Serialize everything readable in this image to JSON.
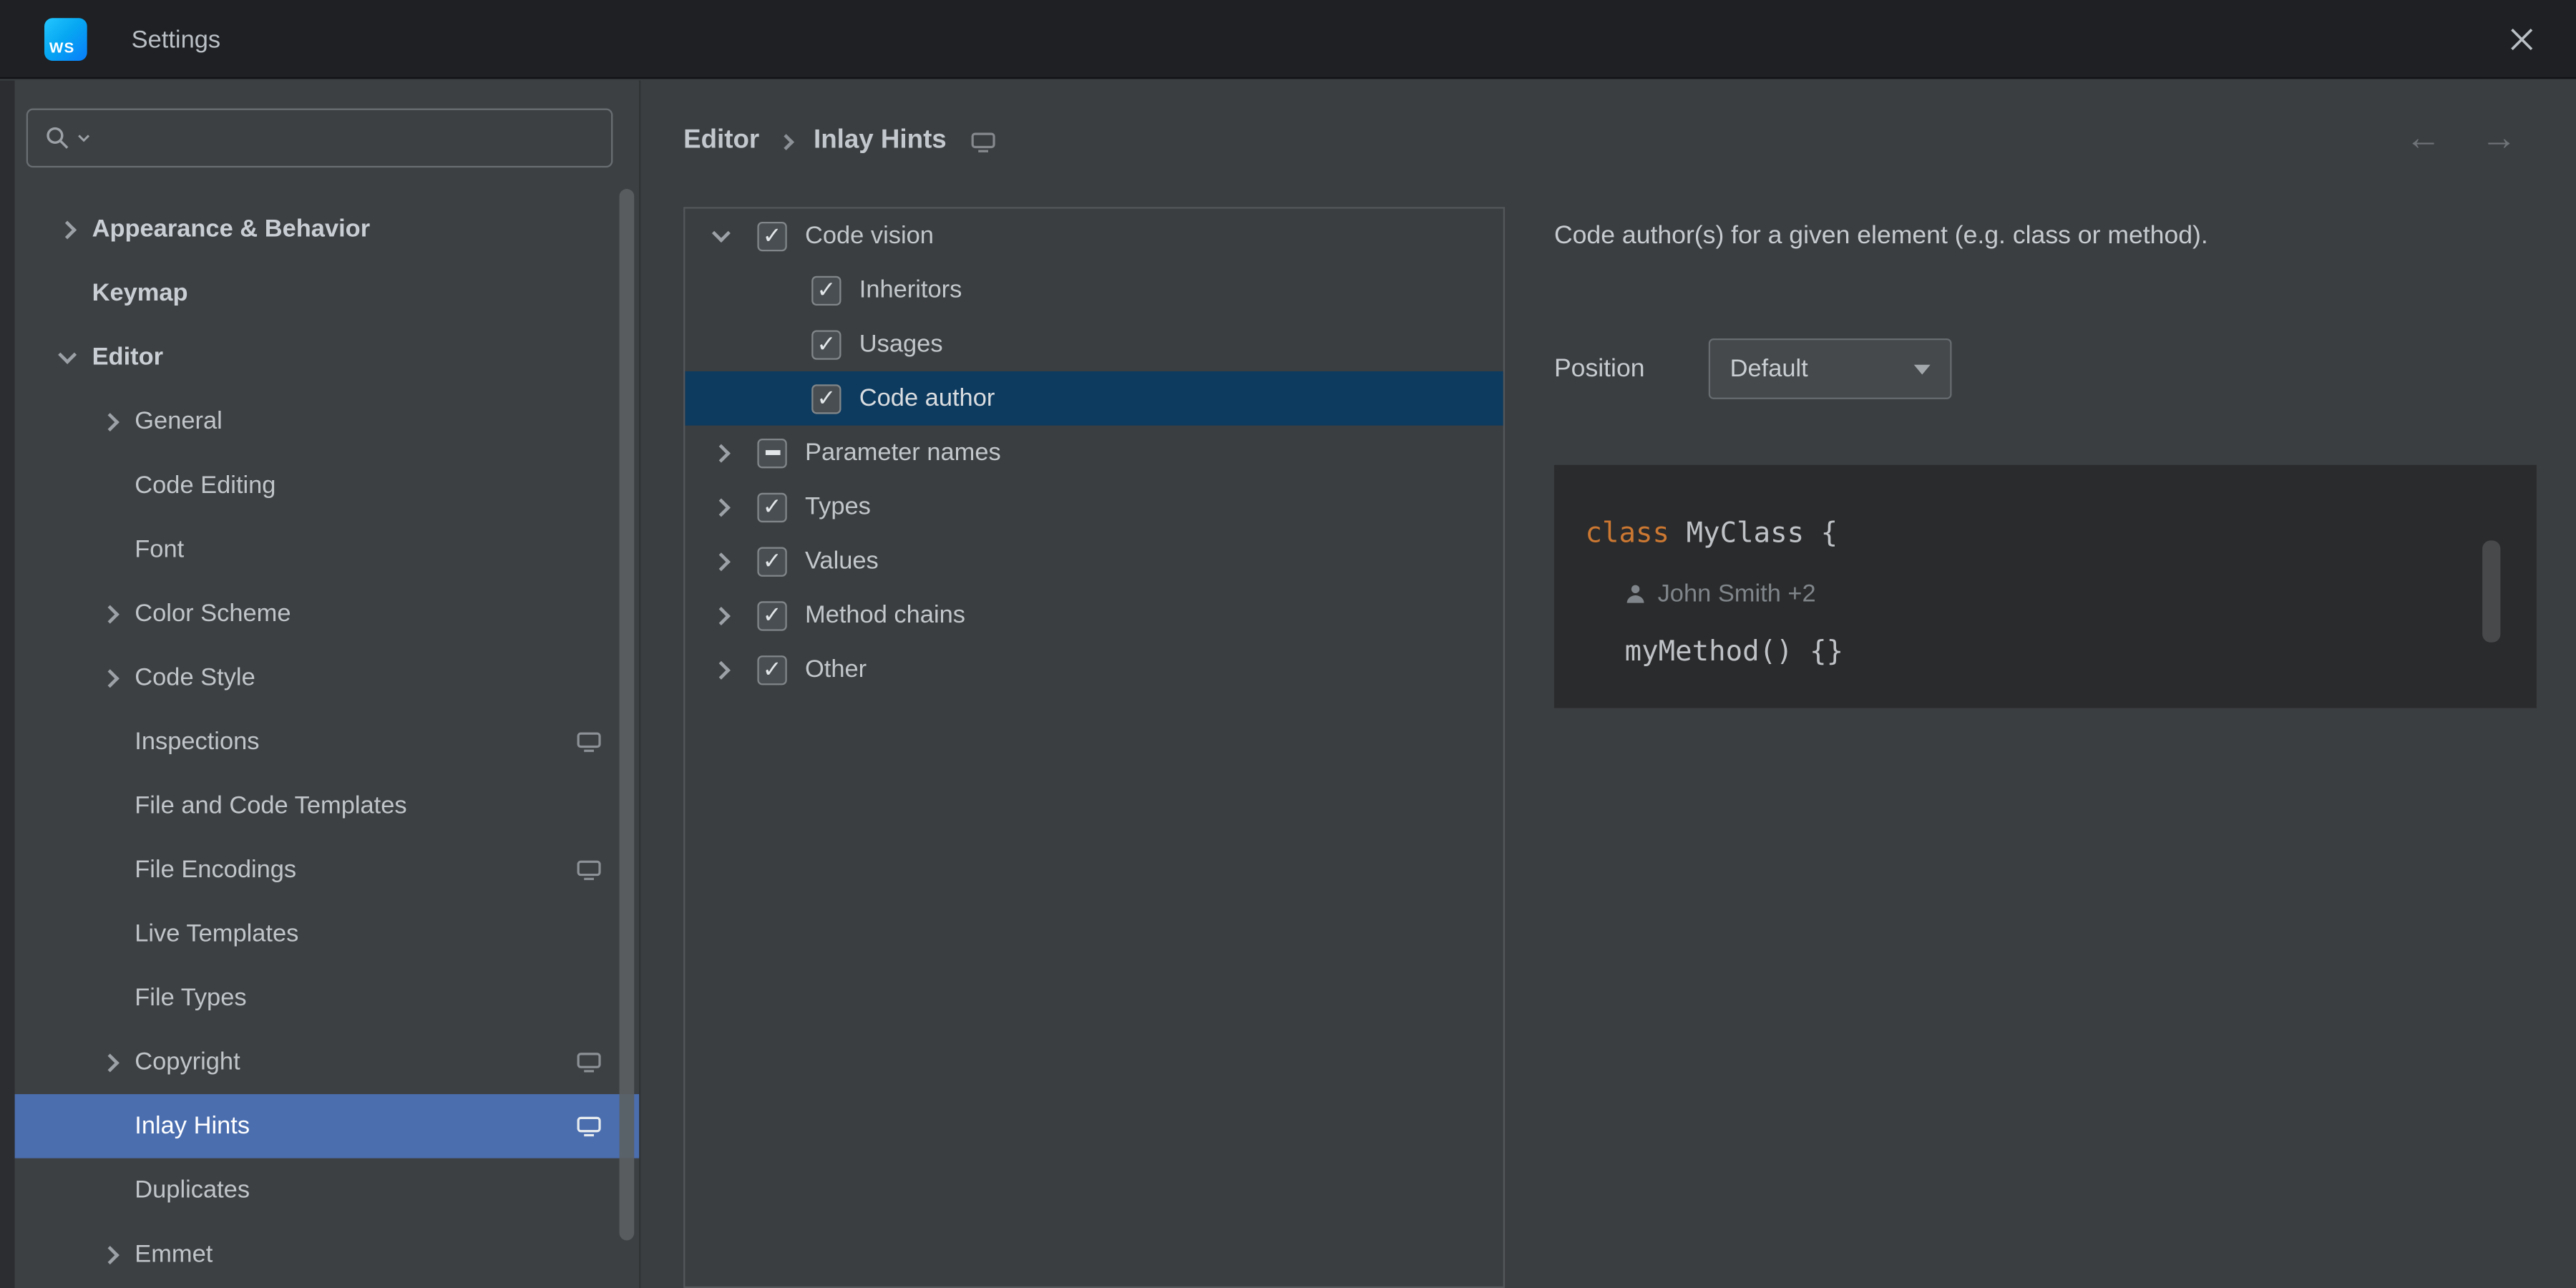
{
  "window": {
    "title": "Settings",
    "logo": "WS"
  },
  "nav": {
    "back": "←",
    "forward": "→"
  },
  "sidebar": {
    "search": {
      "placeholder": ""
    },
    "items": [
      {
        "label": "Appearance & Behavior",
        "level": 1,
        "bold": true,
        "chevron": "collapsed"
      },
      {
        "label": "Keymap",
        "level": 1,
        "bold": true
      },
      {
        "label": "Editor",
        "level": 1,
        "bold": true,
        "chevron": "expanded"
      },
      {
        "label": "General",
        "level": 2,
        "chevron": "collapsed"
      },
      {
        "label": "Code Editing",
        "level": 2
      },
      {
        "label": "Font",
        "level": 2
      },
      {
        "label": "Color Scheme",
        "level": 2,
        "chevron": "collapsed"
      },
      {
        "label": "Code Style",
        "level": 2,
        "chevron": "collapsed"
      },
      {
        "label": "Inspections",
        "level": 2,
        "trailing_icon": "screen-icon"
      },
      {
        "label": "File and Code Templates",
        "level": 2
      },
      {
        "label": "File Encodings",
        "level": 2,
        "trailing_icon": "screen-icon"
      },
      {
        "label": "Live Templates",
        "level": 2
      },
      {
        "label": "File Types",
        "level": 2
      },
      {
        "label": "Copyright",
        "level": 2,
        "chevron": "collapsed",
        "trailing_icon": "screen-icon"
      },
      {
        "label": "Inlay Hints",
        "level": 2,
        "selected": true,
        "trailing_icon": "screen-icon"
      },
      {
        "label": "Duplicates",
        "level": 2
      },
      {
        "label": "Emmet",
        "level": 2,
        "chevron": "collapsed"
      }
    ]
  },
  "breadcrumb": {
    "section": "Editor",
    "page": "Inlay Hints"
  },
  "hints_tree": {
    "rows": [
      {
        "label": "Code vision",
        "level": 1,
        "chevron": "expanded",
        "checkbox": "checked"
      },
      {
        "label": "Inheritors",
        "level": 2,
        "checkbox": "checked"
      },
      {
        "label": "Usages",
        "level": 2,
        "checkbox": "checked"
      },
      {
        "label": "Code author",
        "level": 2,
        "checkbox": "checked",
        "selected": true
      },
      {
        "label": "Parameter names",
        "level": 1,
        "chevron": "collapsed",
        "checkbox": "indeterminate"
      },
      {
        "label": "Types",
        "level": 1,
        "chevron": "collapsed",
        "checkbox": "checked"
      },
      {
        "label": "Values",
        "level": 1,
        "chevron": "collapsed",
        "checkbox": "checked"
      },
      {
        "label": "Method chains",
        "level": 1,
        "chevron": "collapsed",
        "checkbox": "checked"
      },
      {
        "label": "Other",
        "level": 1,
        "chevron": "collapsed",
        "checkbox": "checked"
      }
    ]
  },
  "detail": {
    "description": "Code author(s) for a given element (e.g. class or method).",
    "position_label": "Position",
    "position_value": "Default",
    "preview": {
      "keyword": "class",
      "class_rest": " MyClass {",
      "author_hint": "John Smith +2",
      "method_line": "myMethod() {}"
    }
  },
  "colors": {
    "sidebar_selection": "#4b6eaf",
    "tree_selection": "#0d3a5f",
    "keyword": "#cc7832",
    "preview_bg": "#2a2b2c",
    "titlebar_bg": "#1e2023",
    "panel_bg": "#3b3e41"
  }
}
